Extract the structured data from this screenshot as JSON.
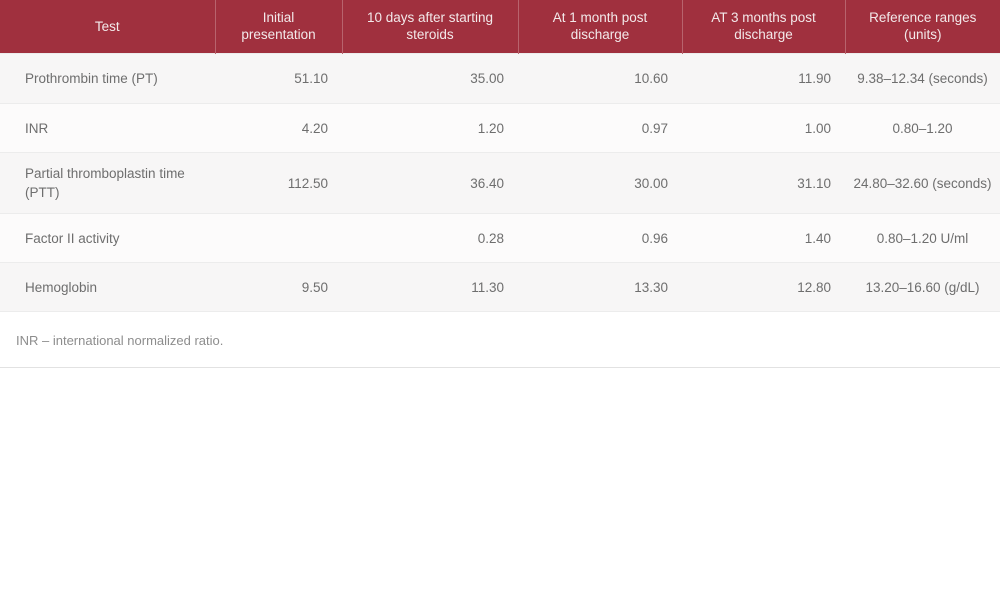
{
  "table": {
    "headers": [
      "Test",
      "Initial presentation",
      "10 days after starting steroids",
      "At 1 month post discharge",
      "AT 3 months post discharge",
      "Reference ranges (units)"
    ],
    "rows": [
      {
        "test": "Prothrombin time (PT)",
        "initial_presentation": "51.10",
        "ten_days_after_steroids": "35.00",
        "one_month_post_discharge": "10.60",
        "three_months_post_discharge": "11.90",
        "reference_range": "9.38–12.34 (seconds)"
      },
      {
        "test": "INR",
        "initial_presentation": "4.20",
        "ten_days_after_steroids": "1.20",
        "one_month_post_discharge": "0.97",
        "three_months_post_discharge": "1.00",
        "reference_range": "0.80–1.20"
      },
      {
        "test": "Partial thromboplastin time (PTT)",
        "initial_presentation": "112.50",
        "ten_days_after_steroids": "36.40",
        "one_month_post_discharge": "30.00",
        "three_months_post_discharge": "31.10",
        "reference_range": "24.80–32.60 (seconds)"
      },
      {
        "test": "Factor II activity",
        "initial_presentation": "",
        "ten_days_after_steroids": "0.28",
        "one_month_post_discharge": "0.96",
        "three_months_post_discharge": "1.40",
        "reference_range": "0.80–1.20 U/ml"
      },
      {
        "test": "Hemoglobin",
        "initial_presentation": "9.50",
        "ten_days_after_steroids": "11.30",
        "one_month_post_discharge": "13.30",
        "three_months_post_discharge": "12.80",
        "reference_range": "13.20–16.60 (g/dL)"
      }
    ],
    "footnote": "INR – international normalized ratio.",
    "colors": {
      "header_background": "#a0303e",
      "header_text": "#f3e9ea",
      "row_background": "#f7f6f6",
      "row_background_alt": "#fcfbfb",
      "body_text": "#6e6e6e",
      "footnote_text": "#8d8d8d",
      "row_border": "#ececec"
    }
  }
}
